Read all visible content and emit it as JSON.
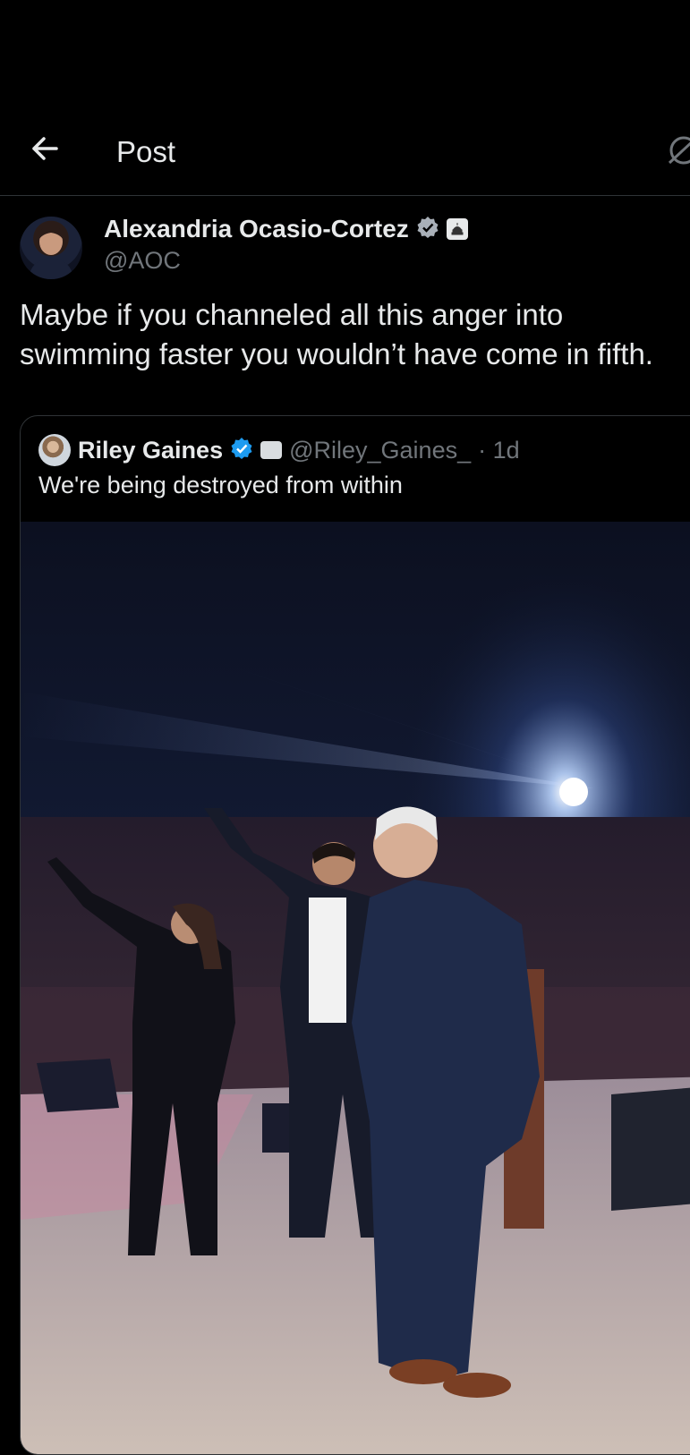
{
  "header": {
    "title": "Post",
    "back_icon": "arrow-left-icon",
    "right_icon": "grok-icon"
  },
  "post": {
    "author_name": "Alexandria Ocasio-Cortez",
    "author_handle": "@AOC",
    "badges": [
      "verified-badge-icon",
      "government-badge-icon"
    ],
    "text": "Maybe if you channeled all this anger into swimming faster you wouldn’t have come in fifth."
  },
  "quoted_post": {
    "author_name": "Riley Gaines",
    "author_handle": "@Riley_Gaines_",
    "time": "· 1d",
    "text": "We're being destroyed from within",
    "media_description_icon": "photo"
  },
  "colors": {
    "background": "#000000",
    "text": "#e7e9ea",
    "muted": "#71767b",
    "verified": "#1d9bf0",
    "border": "#2f3336"
  }
}
